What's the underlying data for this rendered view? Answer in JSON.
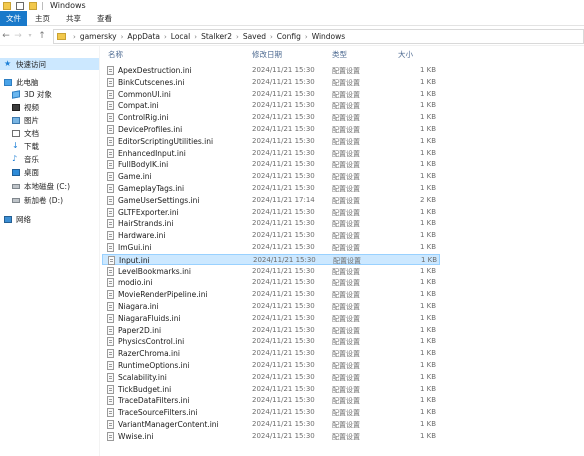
{
  "window": {
    "title": "Windows"
  },
  "ribbon": {
    "tabs": [
      "文件",
      "主页",
      "共享",
      "查看"
    ]
  },
  "address": {
    "path": [
      "gamersky",
      "AppData",
      "Local",
      "Stalker2",
      "Saved",
      "Config",
      "Windows"
    ]
  },
  "sidebar": {
    "items": [
      {
        "label": "快速访问",
        "icon": "star-icon"
      },
      {
        "label": "此电脑",
        "icon": "computer-icon"
      },
      {
        "label": "3D 对象",
        "icon": "3d-objects-icon"
      },
      {
        "label": "视频",
        "icon": "video-icon"
      },
      {
        "label": "图片",
        "icon": "pictures-icon"
      },
      {
        "label": "文档",
        "icon": "documents-icon"
      },
      {
        "label": "下载",
        "icon": "download-icon"
      },
      {
        "label": "音乐",
        "icon": "music-icon"
      },
      {
        "label": "桌面",
        "icon": "desktop-icon"
      },
      {
        "label": "本地磁盘 (C:)",
        "icon": "drive-icon"
      },
      {
        "label": "新加卷 (D:)",
        "icon": "drive-icon"
      },
      {
        "label": "网络",
        "icon": "network-icon"
      }
    ]
  },
  "columns": {
    "name": "名称",
    "date": "修改日期",
    "type": "类型",
    "size": "大小"
  },
  "files": [
    {
      "name": "ApexDestruction.ini",
      "date": "2024/11/21 15:30",
      "type": "配置设置",
      "size": "1 KB"
    },
    {
      "name": "BinkCutscenes.ini",
      "date": "2024/11/21 15:30",
      "type": "配置设置",
      "size": "1 KB"
    },
    {
      "name": "CommonUI.ini",
      "date": "2024/11/21 15:30",
      "type": "配置设置",
      "size": "1 KB"
    },
    {
      "name": "Compat.ini",
      "date": "2024/11/21 15:30",
      "type": "配置设置",
      "size": "1 KB"
    },
    {
      "name": "ControlRig.ini",
      "date": "2024/11/21 15:30",
      "type": "配置设置",
      "size": "1 KB"
    },
    {
      "name": "DeviceProfiles.ini",
      "date": "2024/11/21 15:30",
      "type": "配置设置",
      "size": "1 KB"
    },
    {
      "name": "EditorScriptingUtilities.ini",
      "date": "2024/11/21 15:30",
      "type": "配置设置",
      "size": "1 KB"
    },
    {
      "name": "EnhancedInput.ini",
      "date": "2024/11/21 15:30",
      "type": "配置设置",
      "size": "1 KB"
    },
    {
      "name": "FullBodyIK.ini",
      "date": "2024/11/21 15:30",
      "type": "配置设置",
      "size": "1 KB"
    },
    {
      "name": "Game.ini",
      "date": "2024/11/21 15:30",
      "type": "配置设置",
      "size": "1 KB"
    },
    {
      "name": "GameplayTags.ini",
      "date": "2024/11/21 15:30",
      "type": "配置设置",
      "size": "1 KB"
    },
    {
      "name": "GameUserSettings.ini",
      "date": "2024/11/21 17:14",
      "type": "配置设置",
      "size": "2 KB"
    },
    {
      "name": "GLTFExporter.ini",
      "date": "2024/11/21 15:30",
      "type": "配置设置",
      "size": "1 KB"
    },
    {
      "name": "HairStrands.ini",
      "date": "2024/11/21 15:30",
      "type": "配置设置",
      "size": "1 KB"
    },
    {
      "name": "Hardware.ini",
      "date": "2024/11/21 15:30",
      "type": "配置设置",
      "size": "1 KB"
    },
    {
      "name": "ImGui.ini",
      "date": "2024/11/21 15:30",
      "type": "配置设置",
      "size": "1 KB"
    },
    {
      "name": "Input.ini",
      "date": "2024/11/21 15:30",
      "type": "配置设置",
      "size": "1 KB"
    },
    {
      "name": "LevelBookmarks.ini",
      "date": "2024/11/21 15:30",
      "type": "配置设置",
      "size": "1 KB"
    },
    {
      "name": "modio.ini",
      "date": "2024/11/21 15:30",
      "type": "配置设置",
      "size": "1 KB"
    },
    {
      "name": "MovieRenderPipeline.ini",
      "date": "2024/11/21 15:30",
      "type": "配置设置",
      "size": "1 KB"
    },
    {
      "name": "Niagara.ini",
      "date": "2024/11/21 15:30",
      "type": "配置设置",
      "size": "1 KB"
    },
    {
      "name": "NiagaraFluids.ini",
      "date": "2024/11/21 15:30",
      "type": "配置设置",
      "size": "1 KB"
    },
    {
      "name": "Paper2D.ini",
      "date": "2024/11/21 15:30",
      "type": "配置设置",
      "size": "1 KB"
    },
    {
      "name": "PhysicsControl.ini",
      "date": "2024/11/21 15:30",
      "type": "配置设置",
      "size": "1 KB"
    },
    {
      "name": "RazerChroma.ini",
      "date": "2024/11/21 15:30",
      "type": "配置设置",
      "size": "1 KB"
    },
    {
      "name": "RuntimeOptions.ini",
      "date": "2024/11/21 15:30",
      "type": "配置设置",
      "size": "1 KB"
    },
    {
      "name": "Scalability.ini",
      "date": "2024/11/21 15:30",
      "type": "配置设置",
      "size": "1 KB"
    },
    {
      "name": "TickBudget.ini",
      "date": "2024/11/21 15:30",
      "type": "配置设置",
      "size": "1 KB"
    },
    {
      "name": "TraceDataFilters.ini",
      "date": "2024/11/21 15:30",
      "type": "配置设置",
      "size": "1 KB"
    },
    {
      "name": "TraceSourceFilters.ini",
      "date": "2024/11/21 15:30",
      "type": "配置设置",
      "size": "1 KB"
    },
    {
      "name": "VariantManagerContent.ini",
      "date": "2024/11/21 15:30",
      "type": "配置设置",
      "size": "1 KB"
    },
    {
      "name": "Wwise.ini",
      "date": "2024/11/21 15:30",
      "type": "配置设置",
      "size": "1 KB"
    }
  ],
  "selected_file": "Input.ini",
  "colors": {
    "accent": "#1979ca",
    "selection": "#cce8ff",
    "selection_border": "#99d1ff",
    "header_text": "#4d6a91"
  }
}
